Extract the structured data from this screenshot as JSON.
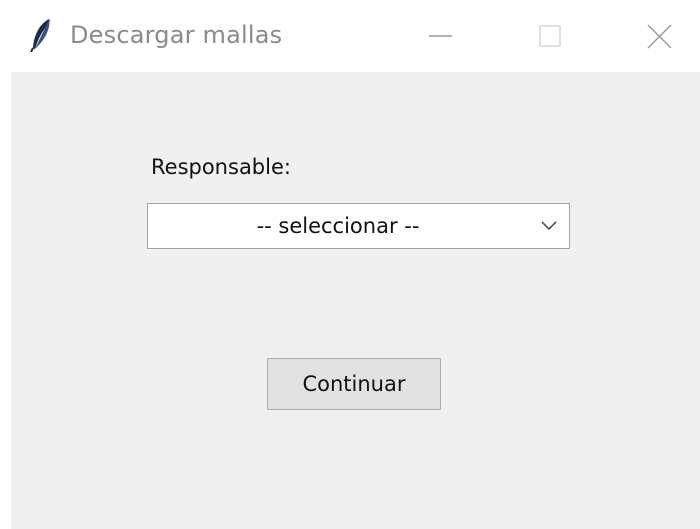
{
  "window": {
    "title": "Descargar mallas",
    "icon": "feather-icon",
    "controls": [
      "minimize-icon",
      "maximize-icon",
      "close-icon"
    ]
  },
  "form": {
    "responsable_label": "Responsable:",
    "responsable_value": "-- seleccionar --",
    "continue_label": "Continuar"
  },
  "colors": {
    "client_bg": "#f0f0f0",
    "title_text": "#8a8a8a",
    "button_bg": "#e1e1e1"
  }
}
